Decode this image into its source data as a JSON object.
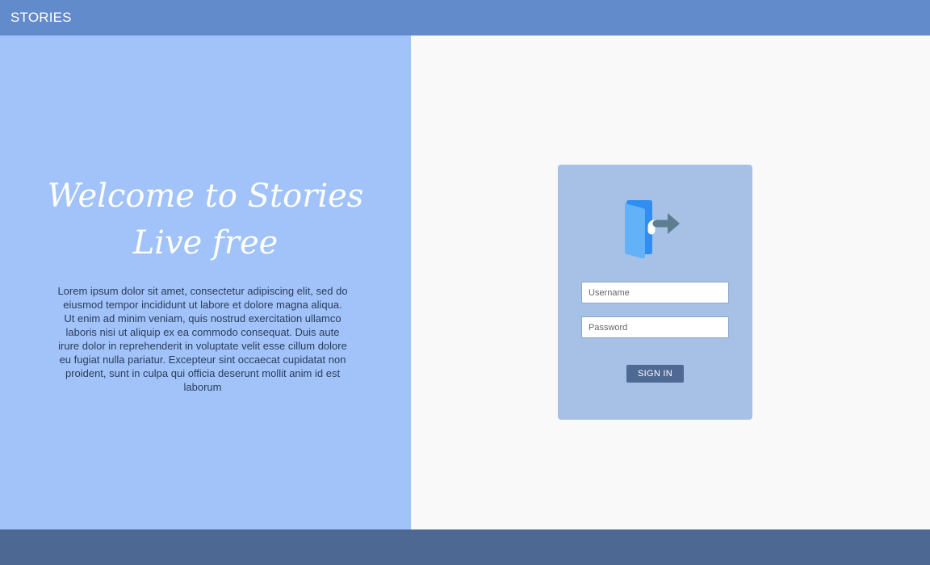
{
  "header": {
    "brand": "STORIES"
  },
  "hero": {
    "title_line1": "Welcome to Stories",
    "title_line2": "Live free",
    "body": "Lorem ipsum dolor sit amet, consectetur adipiscing elit, sed do eiusmod tempor incididunt ut labore et dolore magna aliqua. Ut enim ad minim veniam, quis nostrud exercitation ullamco laboris nisi ut aliquip ex ea commodo consequat. Duis aute irure dolor in reprehenderit in voluptate velit esse cillum dolore eu fugiat nulla pariatur. Excepteur sint occaecat cupidatat non proident, sunt in culpa qui officia deserunt mollit anim id est laborum"
  },
  "login": {
    "icon": "door-exit-icon",
    "username_placeholder": "Username",
    "username_value": "",
    "password_placeholder": "Password",
    "password_value": "",
    "signin_label": "SIGN IN"
  },
  "colors": {
    "header": "#628bcb",
    "hero_bg": "#a2c3fa",
    "card_bg": "#a6c0e6",
    "button": "#4e6993",
    "footer": "#4e6894"
  }
}
